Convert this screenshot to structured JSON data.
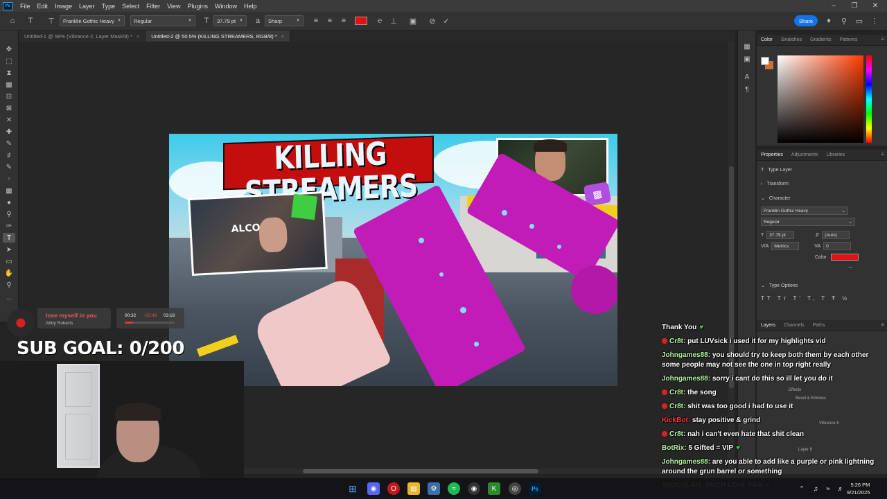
{
  "menu": {
    "logo": "Ps",
    "items": [
      "File",
      "Edit",
      "Image",
      "Layer",
      "Type",
      "Select",
      "Filter",
      "View",
      "Plugins",
      "Window",
      "Help"
    ]
  },
  "options": {
    "font_family": "Franklin Gothic Heavy",
    "font_style": "Regular",
    "font_size": "37.79 pt",
    "antialias": "Sharp",
    "text_color": "#e21212",
    "share_label": "Share"
  },
  "tabs": [
    {
      "label": "Untitled-1 @ 58% (Vibrance 2, Layer Mask/8) *"
    },
    {
      "label": "Untitled-2 @ 50.5% (KILLING STREAMERS, RGB/8) *"
    }
  ],
  "canvas": {
    "title_text": "KILLING STREAMERS",
    "cam_left_text": "ALCOHO"
  },
  "color_panel": {
    "tabs": [
      "Color",
      "Swatches",
      "Gradients",
      "Patterns"
    ]
  },
  "properties_panel": {
    "tabs": [
      "Properties",
      "Adjustments",
      "Libraries"
    ],
    "layer_type": "Type Layer",
    "transform_label": "Transform",
    "character_label": "Character",
    "font_family": "Franklin Gothic Heavy",
    "font_style": "Regular",
    "font_size": "37.79 pt",
    "leading": "(Auto)",
    "kerning": "Metrics",
    "tracking": "0",
    "color_label": "Color",
    "type_options_label": "Type Options"
  },
  "layers_panel": {
    "tabs": [
      "Layers",
      "Channels",
      "Paths"
    ],
    "visible_rows": [
      "Effects",
      "Bevel & Emboss",
      "Vibrance 6",
      "Layer 8"
    ]
  },
  "music": {
    "title": "lose myself in you",
    "artist": "Abby Roberts",
    "elapsed": "00:32",
    "remaining": "-02:46",
    "total": "03:18",
    "progress": 0.17
  },
  "sub_goal": "SUB GOAL: 0/200",
  "chat": [
    {
      "user": "",
      "text": "Thank You",
      "heart": true
    },
    {
      "user": "Cr8t:",
      "text": "put LUVsick i used it for my highlights vid",
      "badge": true
    },
    {
      "user": "Johngames88:",
      "text": "you should try to keep both them by each other some people may not see the one in top right really"
    },
    {
      "user": "Johngames88:",
      "text": "sorry i cant do this so ill let you do it"
    },
    {
      "user": "Cr8t:",
      "text": "the song",
      "badge": true
    },
    {
      "user": "Cr8t:",
      "text": "shit was too good i had to use it",
      "badge": true
    },
    {
      "user": "KickBot:",
      "text": "stay positive & grind",
      "red": true
    },
    {
      "user": "Cr8t:",
      "text": "nah i can't even hate that shit clean",
      "badge": true
    },
    {
      "user": "BotRix:",
      "text": "5 Gifted = VIP",
      "heart": true
    },
    {
      "user": "Johngames88:",
      "text": "are you able to add like a purple or pink lightning around the grun barrel or something"
    },
    {
      "user": "THUGULAH:",
      "text": "MUCH LOVE FAM",
      "heart": true
    }
  ],
  "clock": {
    "time": "5:26 PM",
    "date": "9/21/2025"
  }
}
